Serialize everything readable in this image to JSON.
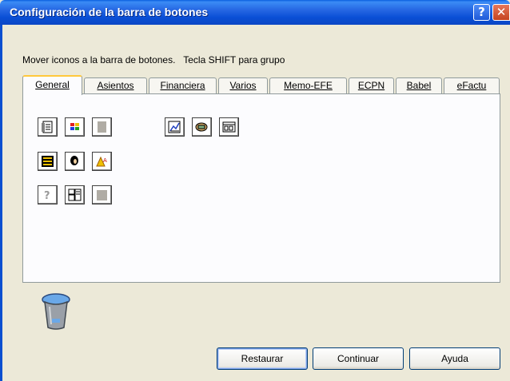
{
  "window": {
    "title": "Configuración de la barra de botones",
    "help_glyph": "?",
    "close_glyph": "✕"
  },
  "instructions": "Mover iconos a la barra de botones.   Tecla SHIFT para grupo",
  "tabs": [
    {
      "label": "General",
      "active": true
    },
    {
      "label": "Asientos",
      "active": false
    },
    {
      "label": "Financiera",
      "active": false
    },
    {
      "label": "Varios",
      "active": false
    },
    {
      "label": "Memo-EFE",
      "active": false
    },
    {
      "label": "ECPN",
      "active": false
    },
    {
      "label": "Babel",
      "active": false
    },
    {
      "label": "eFactu",
      "active": false
    }
  ],
  "icons": [
    {
      "name": "ledger-icon"
    },
    {
      "name": "colors-icon"
    },
    {
      "name": "disabled-grey-icon"
    },
    {
      "name": "chart-doc-icon"
    },
    {
      "name": "money-hand-icon"
    },
    {
      "name": "oo-calc-icon"
    },
    {
      "name": "list-icon"
    },
    {
      "name": "person-icon"
    },
    {
      "name": "sort-az-icon"
    },
    {
      "name": "help-question-icon"
    },
    {
      "name": "window-grid-icon"
    },
    {
      "name": "book-grey-icon"
    }
  ],
  "buttons": {
    "restore": "Restaurar",
    "continue": "Continuar",
    "help": "Ayuda"
  },
  "colors": {
    "titlebar": "#0a4fd6",
    "background": "#ece9d8",
    "active_tab_accent": "#ffc83c"
  }
}
